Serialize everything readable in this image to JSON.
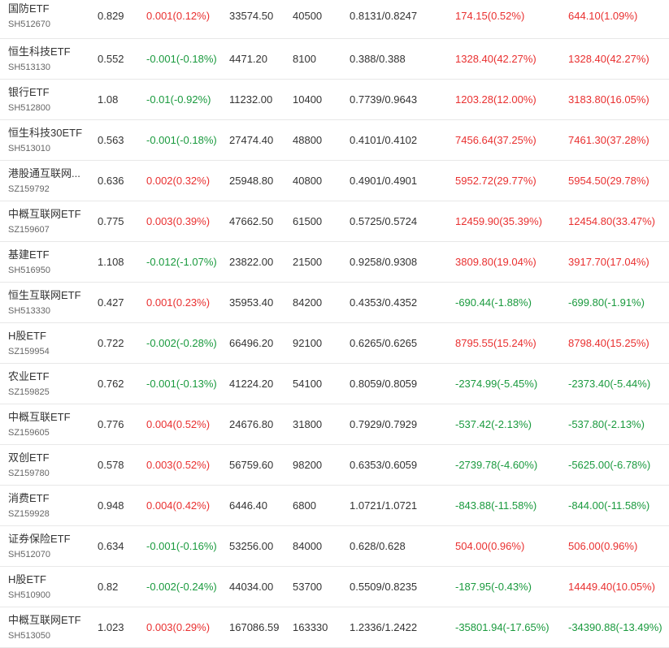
{
  "colors": {
    "up": "#e93030",
    "down": "#1a9a3e",
    "text": "#333333",
    "subtext": "#666666",
    "divider": "#e8e8e8"
  },
  "rows": [
    {
      "name": "国防ETF",
      "code": "SH512670",
      "price": "0.829",
      "change": "0.001(0.12%)",
      "change_dir": "up",
      "volume": "33574.50",
      "volume2": "40500",
      "bid_ask": "0.8131/0.8247",
      "pnl1": "174.15(0.52%)",
      "pnl1_dir": "up",
      "pnl2": "644.10(1.09%)",
      "pnl2_dir": "up"
    },
    {
      "name": "恒生科技ETF",
      "code": "SH513130",
      "price": "0.552",
      "change": "-0.001(-0.18%)",
      "change_dir": "down",
      "volume": "4471.20",
      "volume2": "8100",
      "bid_ask": "0.388/0.388",
      "pnl1": "1328.40(42.27%)",
      "pnl1_dir": "up",
      "pnl2": "1328.40(42.27%)",
      "pnl2_dir": "up"
    },
    {
      "name": "银行ETF",
      "code": "SH512800",
      "price": "1.08",
      "change": "-0.01(-0.92%)",
      "change_dir": "down",
      "volume": "11232.00",
      "volume2": "10400",
      "bid_ask": "0.7739/0.9643",
      "pnl1": "1203.28(12.00%)",
      "pnl1_dir": "up",
      "pnl2": "3183.80(16.05%)",
      "pnl2_dir": "up"
    },
    {
      "name": "恒生科技30ETF",
      "code": "SH513010",
      "price": "0.563",
      "change": "-0.001(-0.18%)",
      "change_dir": "down",
      "volume": "27474.40",
      "volume2": "48800",
      "bid_ask": "0.4101/0.4102",
      "pnl1": "7456.64(37.25%)",
      "pnl1_dir": "up",
      "pnl2": "7461.30(37.28%)",
      "pnl2_dir": "up"
    },
    {
      "name": "港股通互联网...",
      "code": "SZ159792",
      "price": "0.636",
      "change": "0.002(0.32%)",
      "change_dir": "up",
      "volume": "25948.80",
      "volume2": "40800",
      "bid_ask": "0.4901/0.4901",
      "pnl1": "5952.72(29.77%)",
      "pnl1_dir": "up",
      "pnl2": "5954.50(29.78%)",
      "pnl2_dir": "up"
    },
    {
      "name": "中概互联网ETF",
      "code": "SZ159607",
      "price": "0.775",
      "change": "0.003(0.39%)",
      "change_dir": "up",
      "volume": "47662.50",
      "volume2": "61500",
      "bid_ask": "0.5725/0.5724",
      "pnl1": "12459.90(35.39%)",
      "pnl1_dir": "up",
      "pnl2": "12454.80(33.47%)",
      "pnl2_dir": "up"
    },
    {
      "name": "基建ETF",
      "code": "SH516950",
      "price": "1.108",
      "change": "-0.012(-1.07%)",
      "change_dir": "down",
      "volume": "23822.00",
      "volume2": "21500",
      "bid_ask": "0.9258/0.9308",
      "pnl1": "3809.80(19.04%)",
      "pnl1_dir": "up",
      "pnl2": "3917.70(17.04%)",
      "pnl2_dir": "up"
    },
    {
      "name": "恒生互联网ETF",
      "code": "SH513330",
      "price": "0.427",
      "change": "0.001(0.23%)",
      "change_dir": "up",
      "volume": "35953.40",
      "volume2": "84200",
      "bid_ask": "0.4353/0.4352",
      "pnl1": "-690.44(-1.88%)",
      "pnl1_dir": "down",
      "pnl2": "-699.80(-1.91%)",
      "pnl2_dir": "down"
    },
    {
      "name": "H股ETF",
      "code": "SZ159954",
      "price": "0.722",
      "change": "-0.002(-0.28%)",
      "change_dir": "down",
      "volume": "66496.20",
      "volume2": "92100",
      "bid_ask": "0.6265/0.6265",
      "pnl1": "8795.55(15.24%)",
      "pnl1_dir": "up",
      "pnl2": "8798.40(15.25%)",
      "pnl2_dir": "up"
    },
    {
      "name": "农业ETF",
      "code": "SZ159825",
      "price": "0.762",
      "change": "-0.001(-0.13%)",
      "change_dir": "down",
      "volume": "41224.20",
      "volume2": "54100",
      "bid_ask": "0.8059/0.8059",
      "pnl1": "-2374.99(-5.45%)",
      "pnl1_dir": "down",
      "pnl2": "-2373.40(-5.44%)",
      "pnl2_dir": "down"
    },
    {
      "name": "中概互联ETF",
      "code": "SZ159605",
      "price": "0.776",
      "change": "0.004(0.52%)",
      "change_dir": "up",
      "volume": "24676.80",
      "volume2": "31800",
      "bid_ask": "0.7929/0.7929",
      "pnl1": "-537.42(-2.13%)",
      "pnl1_dir": "down",
      "pnl2": "-537.80(-2.13%)",
      "pnl2_dir": "down"
    },
    {
      "name": "双创ETF",
      "code": "SZ159780",
      "price": "0.578",
      "change": "0.003(0.52%)",
      "change_dir": "up",
      "volume": "56759.60",
      "volume2": "98200",
      "bid_ask": "0.6353/0.6059",
      "pnl1": "-2739.78(-4.60%)",
      "pnl1_dir": "down",
      "pnl2": "-5625.00(-6.78%)",
      "pnl2_dir": "down"
    },
    {
      "name": "消费ETF",
      "code": "SZ159928",
      "price": "0.948",
      "change": "0.004(0.42%)",
      "change_dir": "up",
      "volume": "6446.40",
      "volume2": "6800",
      "bid_ask": "1.0721/1.0721",
      "pnl1": "-843.88(-11.58%)",
      "pnl1_dir": "down",
      "pnl2": "-844.00(-11.58%)",
      "pnl2_dir": "down"
    },
    {
      "name": "证券保险ETF",
      "code": "SH512070",
      "price": "0.634",
      "change": "-0.001(-0.16%)",
      "change_dir": "down",
      "volume": "53256.00",
      "volume2": "84000",
      "bid_ask": "0.628/0.628",
      "pnl1": "504.00(0.96%)",
      "pnl1_dir": "up",
      "pnl2": "506.00(0.96%)",
      "pnl2_dir": "up"
    },
    {
      "name": "H股ETF",
      "code": "SH510900",
      "price": "0.82",
      "change": "-0.002(-0.24%)",
      "change_dir": "down",
      "volume": "44034.00",
      "volume2": "53700",
      "bid_ask": "0.5509/0.8235",
      "pnl1": "-187.95(-0.43%)",
      "pnl1_dir": "down",
      "pnl2": "14449.40(10.05%)",
      "pnl2_dir": "up"
    },
    {
      "name": "中概互联网ETF",
      "code": "SH513050",
      "price": "1.023",
      "change": "0.003(0.29%)",
      "change_dir": "up",
      "volume": "167086.59",
      "volume2": "163330",
      "bid_ask": "1.2336/1.2422",
      "pnl1": "-35801.94(-17.65%)",
      "pnl1_dir": "down",
      "pnl2": "-34390.88(-13.49%)",
      "pnl2_dir": "down"
    }
  ]
}
